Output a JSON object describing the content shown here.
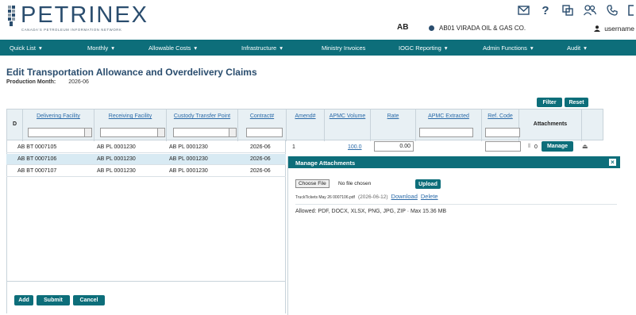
{
  "header": {
    "brand": "PETRINEX",
    "tagline": "CANADA'S PETROLEUM INFORMATION NETWORK",
    "jurisdiction": "AB",
    "organization": "AB01 VIRADA OIL & GAS CO.",
    "username": "username",
    "icons": [
      "mail-icon",
      "help-icon",
      "switch-icon",
      "users-icon",
      "phone-icon",
      "logout-icon"
    ]
  },
  "nav": [
    {
      "label": "Quick List",
      "caret": true
    },
    {
      "label": "Monthly",
      "caret": true
    },
    {
      "label": "Allowable Costs",
      "caret": true
    },
    {
      "label": "Infrastructure",
      "caret": true
    },
    {
      "label": "Ministry Invoices",
      "caret": false
    },
    {
      "label": "IOGC Reporting",
      "caret": true
    },
    {
      "label": "Admin Functions",
      "caret": true
    },
    {
      "label": "Audit",
      "caret": true
    }
  ],
  "page": {
    "title": "Edit Transportation Allowance and Overdelivery Claims",
    "month_label": "Production Month:",
    "month_value": "2026-06",
    "filter_label": "Filter",
    "reset_label": "Reset"
  },
  "table": {
    "headers": {
      "d": "D",
      "delivering": "Delivering Facility",
      "receiving": "Receiving Facility",
      "custody": "Custody Transfer Point",
      "contract": "Contract#",
      "amend": "Amend#",
      "apmc": "APMC Volume",
      "rate": "Rate",
      "extracted": "APMC Extracted",
      "refcode": "Ref. Code",
      "attachments": "Attachments"
    },
    "rows": [
      {
        "delivering": "AB BT 0007105",
        "receiving": "AB PL 0001230",
        "custody": "AB PL 0001230",
        "contract": "2026-06",
        "amend": "1",
        "apmc": "100.0",
        "rate": "0.00",
        "attach_count": "0",
        "manage": "Manage"
      },
      {
        "delivering": "AB BT 0007106",
        "receiving": "AB PL 0001230",
        "custody": "AB PL 0001230",
        "contract": "2026-06"
      },
      {
        "delivering": "AB BT 0007107",
        "receiving": "AB PL 0001230",
        "custody": "AB PL 0001230",
        "contract": "2026-06"
      }
    ]
  },
  "actions": {
    "add": "Add",
    "submit": "Submit",
    "cancel": "Cancel"
  },
  "dialog": {
    "title": "Manage Attachments",
    "close": "×",
    "choose_file": "Choose File",
    "no_file": "No file chosen",
    "upload": "Upload",
    "file_name": "TruckTickets May 26 0007106.pdf",
    "file_date": "(2026-06-12)",
    "download": "Download",
    "delete": "Delete",
    "allowed": "Allowed: PDF, DOCX, XLSX, PNG, JPG, ZIP · Max 15.36 MB"
  },
  "colors": {
    "teal": "#0d6e7a",
    "navy": "#2a4d6e",
    "link": "#2a6aa8"
  }
}
